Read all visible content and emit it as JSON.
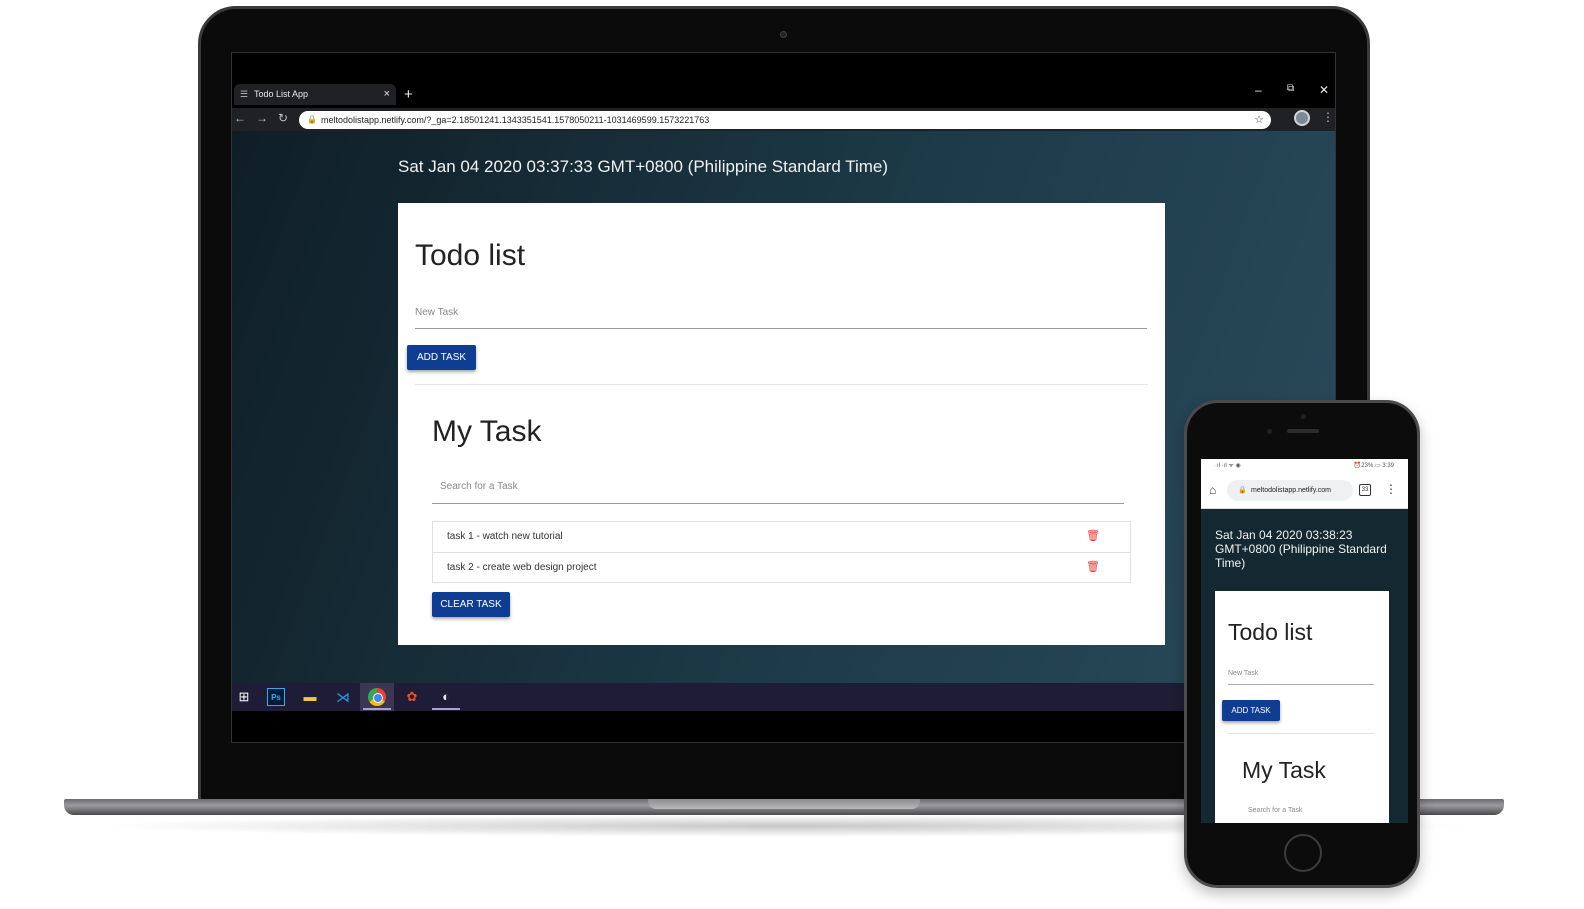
{
  "browser": {
    "tab_title": "Todo List App",
    "tab_icon": "list-icon",
    "tab_close": "×",
    "new_tab": "+",
    "minimize": "–",
    "restore": "⧉",
    "close": "✕",
    "back": "←",
    "forward": "→",
    "reload": "↻",
    "url": "meltodolistapp.netlify.com/?_ga=2.18501241.1343351541.1578050211-1031469599.1573221763",
    "lock": "🔒",
    "star": "☆",
    "menu": "⋮"
  },
  "app": {
    "datetime": "Sat Jan 04 2020 03:37:33 GMT+0800 (Philippine Standard Time)",
    "title": "Todo list",
    "new_task_placeholder": "New Task",
    "add_task_label": "ADD TASK",
    "tasks_title": "My Task",
    "search_placeholder": "Search for a Task",
    "tasks": [
      {
        "text": "task 1 - watch new tutorial"
      },
      {
        "text": "task 2 - create web design project"
      }
    ],
    "delete_icon": "🗑",
    "clear_task_label": "CLEAR TASK",
    "accent_color": "#0f3d91",
    "delete_color": "#e53935"
  },
  "taskbar": {
    "items": [
      "windows-start-icon",
      "photoshop-icon",
      "file-explorer-icon",
      "vscode-icon",
      "chrome-icon",
      "figma-icon",
      "paint-icon"
    ],
    "ps_label": "Ps"
  },
  "mobile": {
    "status_left": "·ıl ·ıl ᯤ ◉",
    "status_right": "⏰23% ▭ 3:39",
    "url": "meltodolistapp.netlify.com",
    "tab_count": "33",
    "menu": "⋮",
    "datetime": "Sat Jan 04 2020 03:38:23 GMT+0800 (Philippine Standard Time)",
    "title": "Todo list",
    "new_task_placeholder": "New Task",
    "add_task_label": "ADD TASK",
    "tasks_title": "My Task",
    "search_placeholder": "Search for a Task"
  }
}
